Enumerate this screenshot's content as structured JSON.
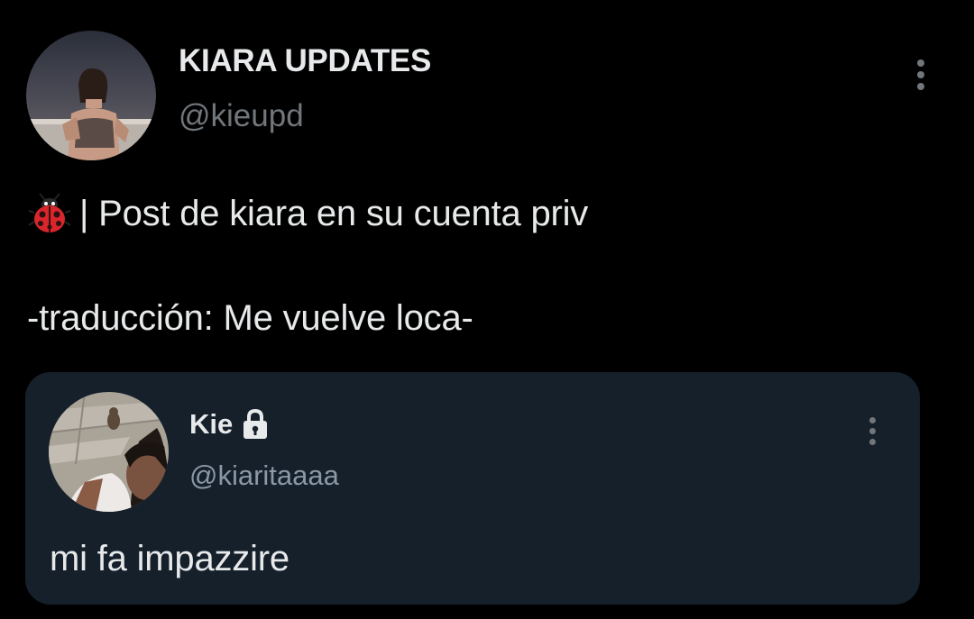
{
  "main_tweet": {
    "author": {
      "display_name": "KIARA UPDATES",
      "handle": "@kieupd"
    },
    "lines": [
      "| Post de kiara en su cuenta priv",
      "-traducción: Me vuelve loca-"
    ],
    "emoji_icon": "ladybug-icon"
  },
  "quoted_tweet": {
    "author": {
      "display_name": "Kie",
      "handle": "@kiaritaaaa",
      "protected_icon": "lock-icon"
    },
    "text": "mi fa impazzire"
  },
  "colors": {
    "background": "#000000",
    "card_background": "#15202b",
    "primary_text": "#e7e9ea",
    "secondary_text": "#71767b"
  }
}
